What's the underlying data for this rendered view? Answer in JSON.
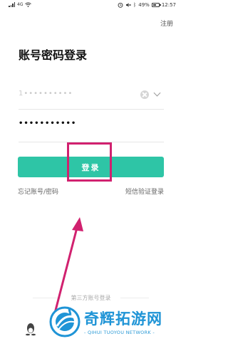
{
  "status_bar": {
    "network": "4G",
    "battery": "49%",
    "time": "12:57"
  },
  "header": {
    "register": "注册"
  },
  "title": "账号密码登录",
  "account": {
    "value": "1••••••••••"
  },
  "password": {
    "value": "•••••••••••"
  },
  "login_button": {
    "label": "登录"
  },
  "links": {
    "forgot": "忘记账号/密码",
    "sms_login": "短信验证登录"
  },
  "third_party": {
    "label": "第三方账号登录"
  },
  "watermark": {
    "name": "奇辉拓游网",
    "subtitle": "- QIHUI TUOYOU NETWORK -"
  },
  "colors": {
    "accent": "#2ec5a6",
    "annotation": "#d1216f",
    "watermark": "#1f94d6"
  },
  "icons": [
    "signal-icon",
    "wifi-icon",
    "alarm-icon",
    "mute-icon",
    "bluetooth-icon",
    "battery-icon",
    "clear-icon",
    "chevron-down-icon",
    "qq-icon"
  ]
}
